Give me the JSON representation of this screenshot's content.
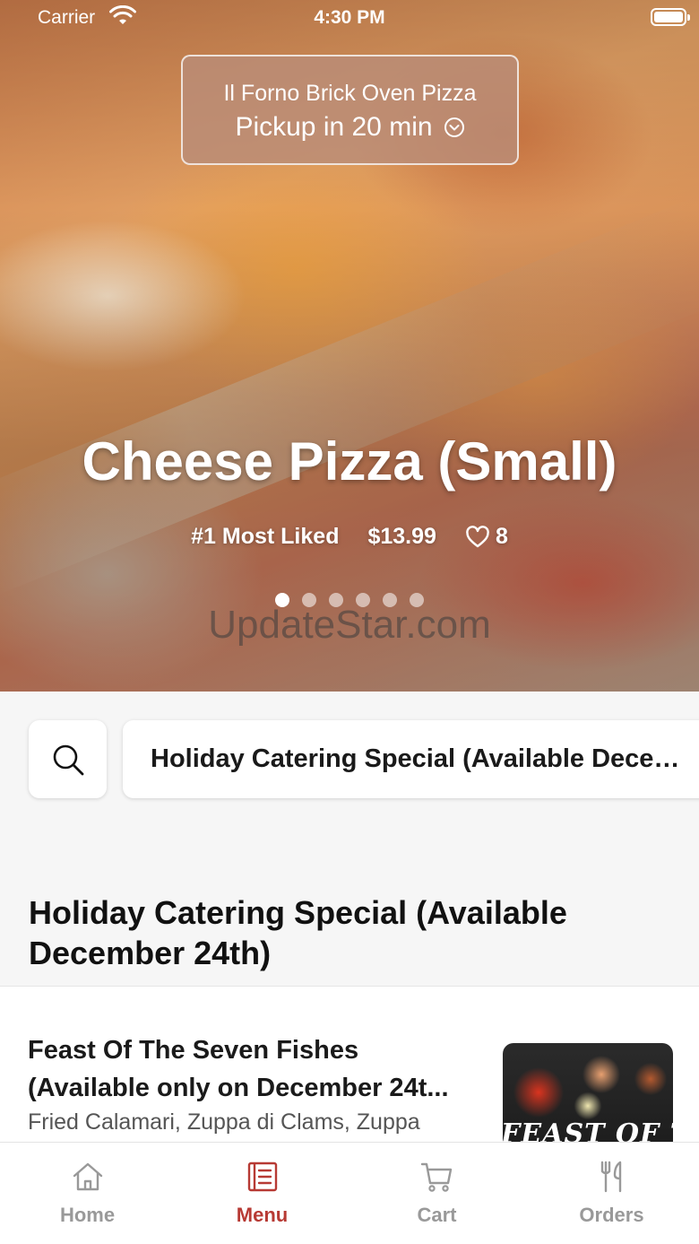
{
  "status_bar": {
    "carrier": "Carrier",
    "time": "4:30 PM"
  },
  "store": {
    "name": "Il Forno Brick Oven Pizza",
    "pickup": "Pickup in 20 min"
  },
  "hero": {
    "title": "Cheese Pizza (Small)",
    "badge": "#1 Most Liked",
    "price": "$13.99",
    "likes": "8",
    "slides_total": 6,
    "active_slide": 1,
    "watermark": "UpdateStar.com"
  },
  "search": {
    "icon": "search-icon"
  },
  "category_selector": {
    "selected": "Holiday Catering Special (Available December 24th)"
  },
  "section": {
    "title": "Holiday Catering Special (Available December 24th)"
  },
  "menu_items": [
    {
      "title": "Feast Of The Seven Fishes (Available only on December 24t...",
      "description": "Fried Calamari, Zuppa di Clams, Zuppa",
      "image_caption": "FEAST OF T"
    }
  ],
  "tab_bar": {
    "active": "Menu",
    "accent": "#b73a34",
    "inactive_color": "#999999",
    "tabs": [
      {
        "label": "Home",
        "icon": "home-icon"
      },
      {
        "label": "Menu",
        "icon": "menu-icon"
      },
      {
        "label": "Cart",
        "icon": "cart-icon"
      },
      {
        "label": "Orders",
        "icon": "utensils-icon"
      }
    ]
  }
}
